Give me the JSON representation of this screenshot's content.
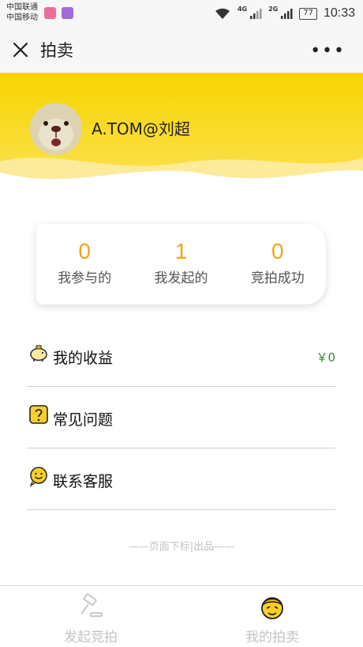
{
  "status_bar": {
    "carrier_line1": "中国联通",
    "carrier_line2": "中国移动",
    "net_a": "4G",
    "net_b": "2G",
    "battery": "77",
    "time": "10:33"
  },
  "title_bar": {
    "title": "拍卖",
    "more": "•••"
  },
  "profile": {
    "username": "A.TOM@刘超"
  },
  "stats": [
    {
      "value": "0",
      "label": "我参与的"
    },
    {
      "value": "1",
      "label": "我发起的"
    },
    {
      "value": "0",
      "label": "竞拍成功"
    }
  ],
  "menu": {
    "earnings": {
      "label": "我的收益",
      "value": "￥0"
    },
    "faq": {
      "label": "常见问题"
    },
    "service": {
      "label": "联系客服"
    }
  },
  "footer_note": "——页面下标|出品——",
  "bottom_nav": {
    "start_auction": "发起竞拍",
    "my_auction": "我的拍卖"
  },
  "colors": {
    "brand_yellow": "#f8d400",
    "stat_orange": "#f3a31c",
    "earnings_green": "#2f8a2f"
  }
}
